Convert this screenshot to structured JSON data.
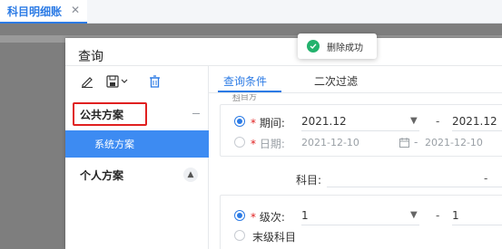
{
  "tabbar": {
    "tab_label": "科目明细账",
    "close_glyph": "✕"
  },
  "dialog": {
    "title": "查询"
  },
  "toast": {
    "text": "删除成功",
    "icon": "check-circle-icon",
    "color": "#23b26d"
  },
  "left_panel": {
    "toolbar": [
      "edit-icon",
      "save-dropdown-icon",
      "delete-icon"
    ],
    "public_scheme": "公共方案",
    "system_scheme": "系统方案",
    "personal_scheme": "个人方案",
    "collapse_glyph": "▲"
  },
  "right_panel": {
    "tabs": [
      "查询条件",
      "二次过滤"
    ],
    "faint_label": "科目方案",
    "period": {
      "label": "期间:",
      "from": "2021.12",
      "to": "2021.12"
    },
    "date": {
      "label": "日期:",
      "from": "2021-12-10",
      "to": "2021-12-10"
    },
    "subject": {
      "label": "科目:",
      "dash": "-"
    },
    "level": {
      "label": "级次:",
      "from": "1",
      "to": "1"
    },
    "leaf": {
      "label": "末级科目"
    },
    "required_mark": "*",
    "range_dash": "-"
  },
  "colors": {
    "accent": "#2c7be5",
    "selected_bg": "#3d8bf2",
    "highlight_border": "#e02020"
  }
}
